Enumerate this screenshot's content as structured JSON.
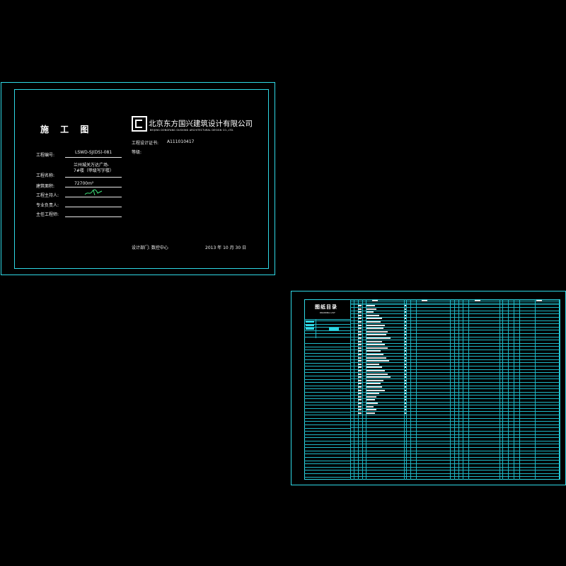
{
  "cover": {
    "title": "施 工 图",
    "company_name": "北京东方国兴建筑设计有限公司",
    "company_en": "BEIJING DONGFANG GUOXING ARCHITECTURAL DESIGN CO.,LTD.",
    "cert_label": "工程设计证书:",
    "cert_value": "A111010417",
    "grade_label": "等级:",
    "fields": [
      {
        "label": "工程编号:",
        "value": "LSWD-SJ(DS)-081"
      },
      {
        "label": "工程名称:",
        "value": "兰州城关万达广场-\n7#楼（甲级写字楼）"
      },
      {
        "label": "建筑面积:",
        "value": "72700m²"
      },
      {
        "label": "工程主持人:",
        "value": ""
      },
      {
        "label": "专业负责人:",
        "value": ""
      },
      {
        "label": "主任工程师:",
        "value": ""
      }
    ],
    "dept_label": "设计部门: 数控中心",
    "date": "2013 年 10 月 30 日"
  },
  "index_sheet": {
    "title": "图纸目录",
    "subtitle": "DRAWING LIST",
    "colors": {
      "line": "#1fb8c6",
      "border": "#2fd9e6"
    }
  }
}
